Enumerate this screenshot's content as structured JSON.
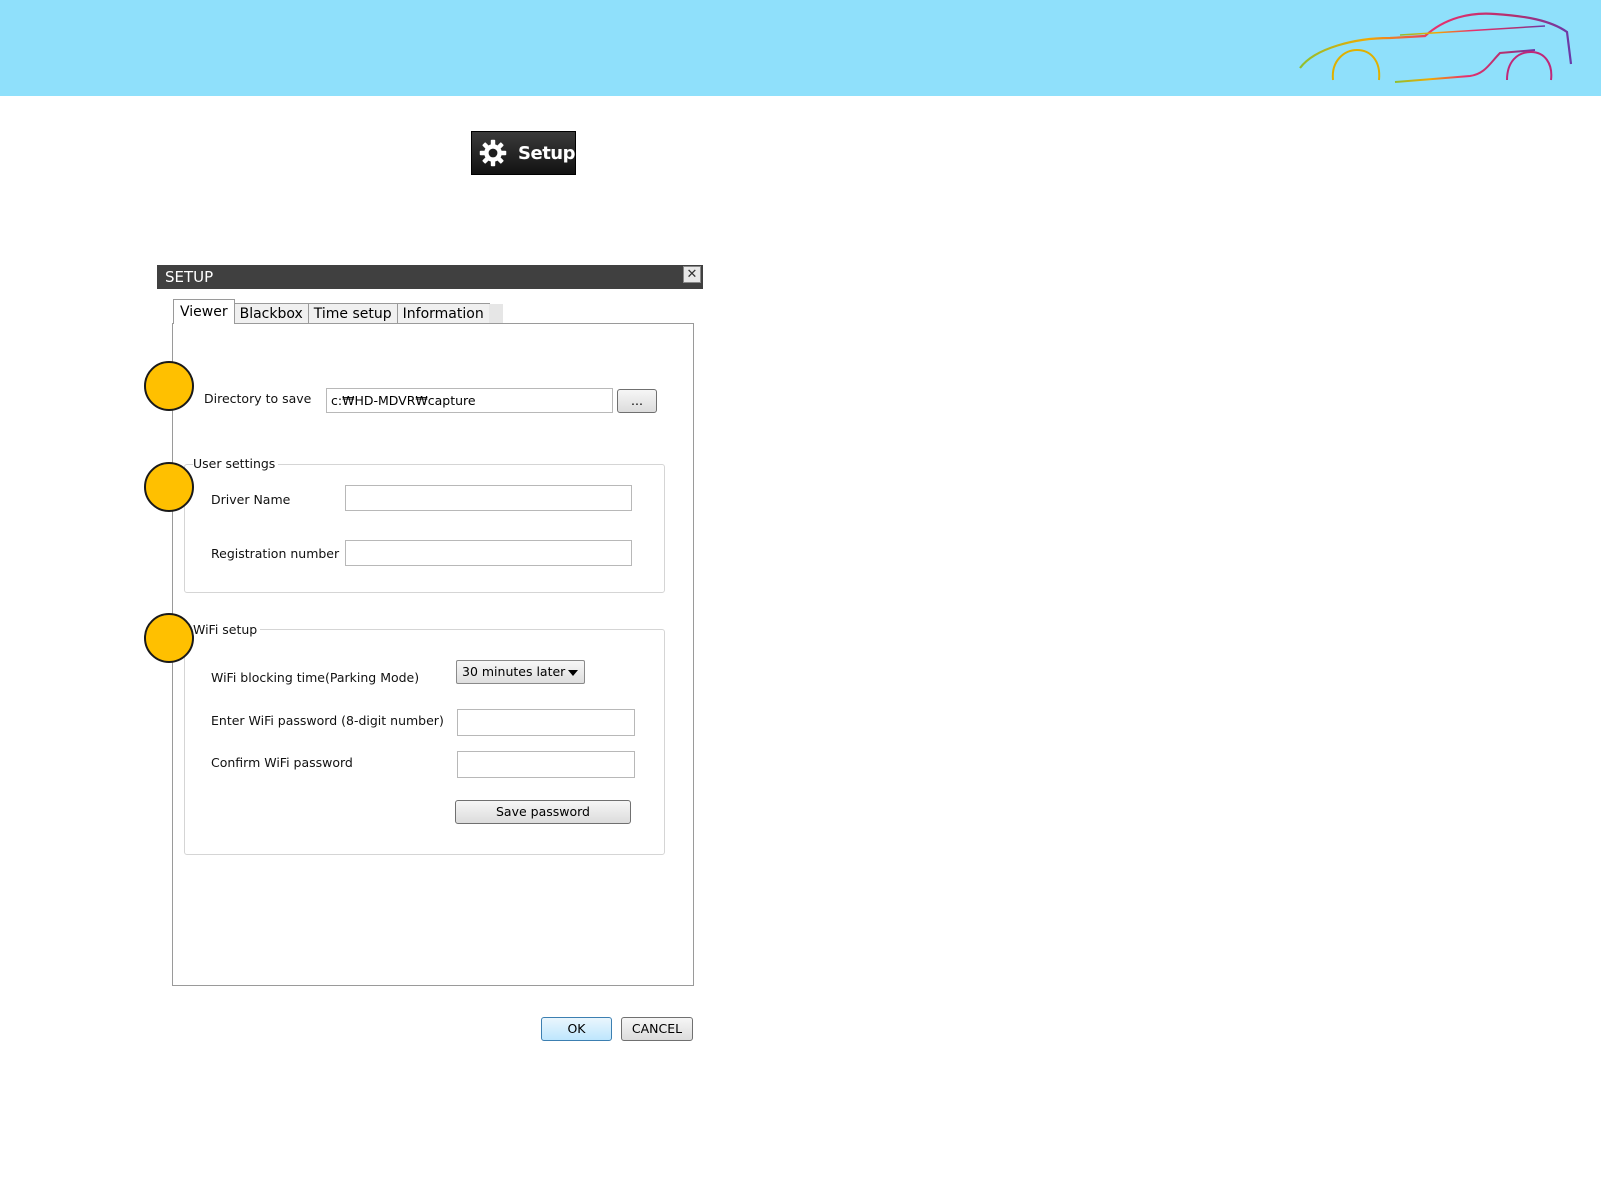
{
  "setup_button": {
    "label": "Setup",
    "icon": "gear-icon"
  },
  "dialog": {
    "title": "SETUP",
    "close_label": "✕",
    "tabs": [
      {
        "label": "Viewer",
        "active": true
      },
      {
        "label": "Blackbox",
        "active": false
      },
      {
        "label": "Time setup",
        "active": false
      },
      {
        "label": "Information",
        "active": false
      }
    ],
    "viewer": {
      "directory_label": "Directory to save",
      "directory_value": "c:₩HD-MDVR₩capture",
      "browse_label": "...",
      "user_settings": {
        "title": "User settings",
        "driver_name_label": "Driver Name",
        "driver_name_value": "",
        "registration_label": "Registration number",
        "registration_value": ""
      },
      "wifi_setup": {
        "title": "WiFi setup",
        "blocking_time_label": "WiFi blocking time(Parking Mode)",
        "blocking_time_value": "30 minutes later",
        "password_label": "Enter WiFi password (8-digit number)",
        "password_value": "",
        "confirm_label": "Confirm WiFi password",
        "confirm_value": "",
        "save_password_label": "Save password"
      }
    },
    "ok_label": "OK",
    "cancel_label": "CANCEL"
  },
  "colors": {
    "banner": "#8fe0fb",
    "marker": "#ffc000",
    "titlebar": "#404040"
  }
}
